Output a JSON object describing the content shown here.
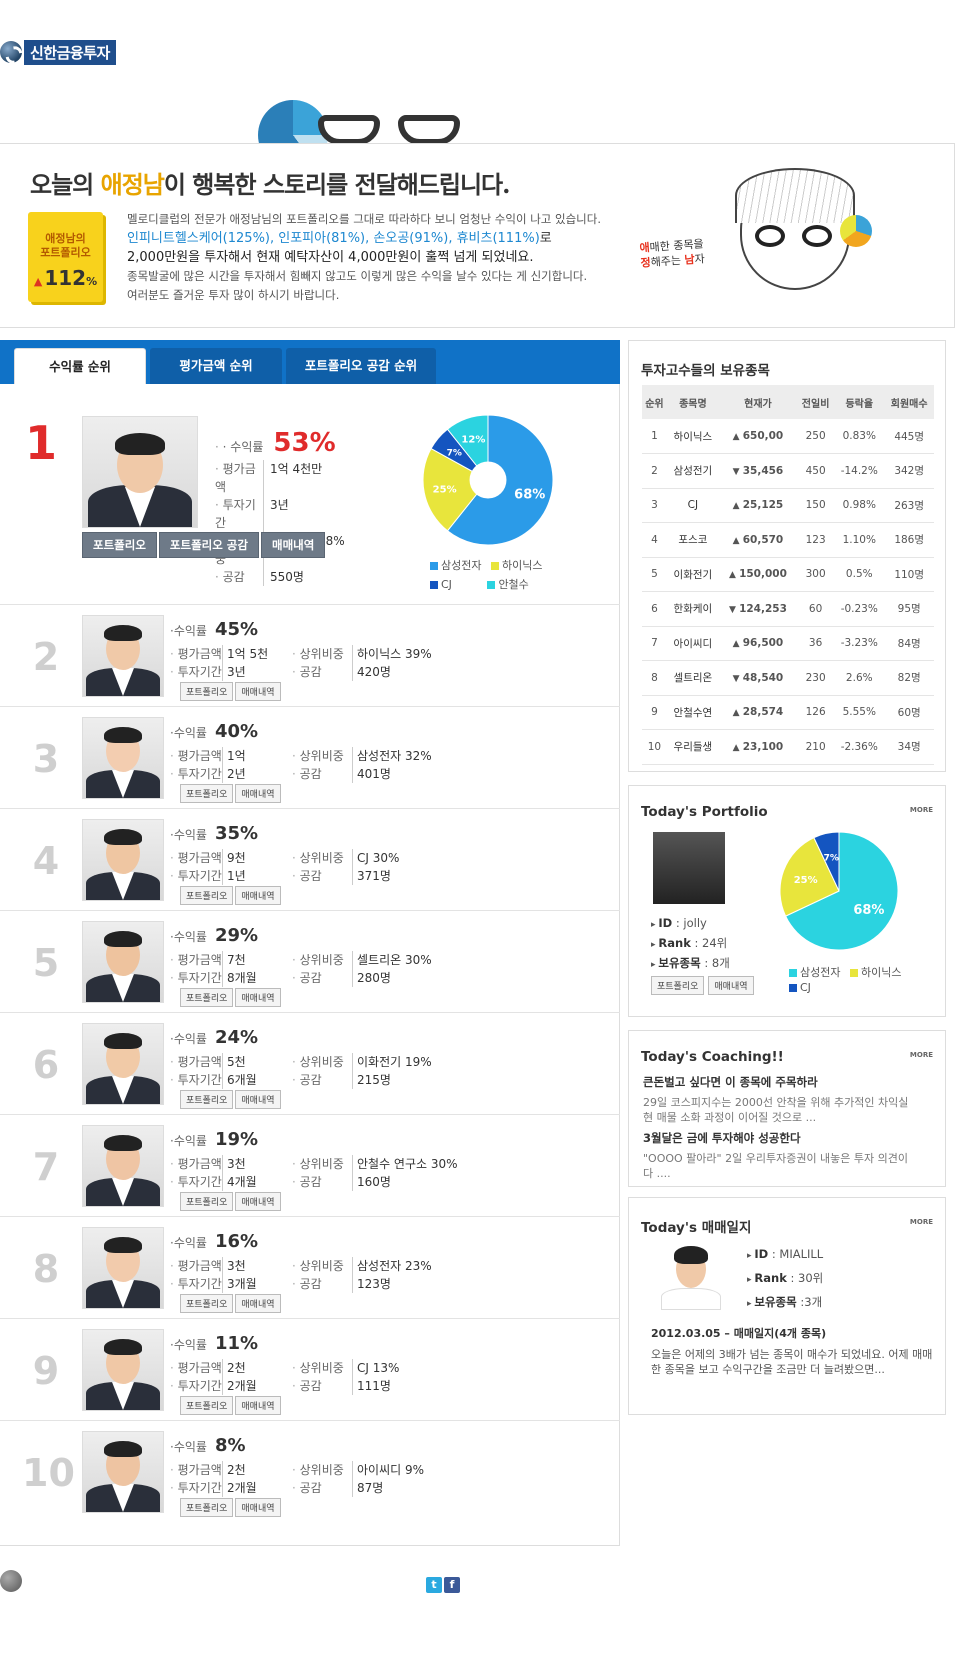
{
  "brand": {
    "logo_text": "신한금융투자"
  },
  "hero": {
    "title_pre": "오늘의 ",
    "title_highlight": "애정남",
    "title_post": "이 행복한 스토리를 전달해드립니다.",
    "badge_label1": "애정남의",
    "badge_label2": "포트폴리오",
    "badge_value": "112",
    "badge_unit": "%",
    "line1": "멜로디클럽의 전문가 애정남님의 포트폴리오를 그대로 따라하다 보니 엄청난 수익이 나고 있습니다.",
    "line2_blue": "인피니트헬스케어(125%), 인포피아(81%), 손오공(91%), 휴비츠(111%)",
    "line2_tail": "로",
    "line3": "2,000만원을 투자해서 현재 예탁자산이 4,000만원이 훌쩍 넘게 되었네요.",
    "line4": "종목발굴에 많은 시간을 투자해서 힘빼지 않고도 이렇게 많은 수익을 날수 있다는 게 신기합니다.",
    "line5": "여러분도 즐거운 투자 많이 하시기 바랍니다.",
    "tagline1_a": "애",
    "tagline1_b": "매한 종목을",
    "tagline2_a": "정",
    "tagline2_b": "해주는 ",
    "tagline2_c": "남",
    "tagline2_d": "자"
  },
  "tabs": [
    "수익률 순위",
    "평가금액 순위",
    "포트폴리오 공감 순위"
  ],
  "labels": {
    "yield": "수익률",
    "eval": "평가금액",
    "period": "투자기간",
    "top_ratio": "상위비중",
    "empathy": "공감",
    "btn_portfolio": "포트폴리오",
    "btn_portfolio_empathy": "포트폴리오 공감",
    "btn_trades": "매매내역"
  },
  "rank1": {
    "rank": "1",
    "yield": "53%",
    "eval": "1억 4천만",
    "period": "3년",
    "top": "삼성전자 68%",
    "empathy": "550명",
    "legend": [
      "삼성전자",
      "하이닉스",
      "CJ",
      "안철수"
    ]
  },
  "ranks": [
    {
      "rank": "2",
      "yield": "45%",
      "eval": "1억 5천",
      "period": "3년",
      "top": "하이닉스 39%",
      "empathy": "420명"
    },
    {
      "rank": "3",
      "yield": "40%",
      "eval": "1억",
      "period": "2년",
      "top": "삼성전자 32%",
      "empathy": "401명"
    },
    {
      "rank": "4",
      "yield": "35%",
      "eval": "9천",
      "period": "1년",
      "top": "CJ 30%",
      "empathy": "371명"
    },
    {
      "rank": "5",
      "yield": "29%",
      "eval": "7천",
      "period": "8개월",
      "top": "셀트리온 30%",
      "empathy": "280명"
    },
    {
      "rank": "6",
      "yield": "24%",
      "eval": "5천",
      "period": "6개월",
      "top": "이화전기 19%",
      "empathy": "215명"
    },
    {
      "rank": "7",
      "yield": "19%",
      "eval": "3천",
      "period": "4개월",
      "top": "안철수 연구소 30%",
      "empathy": "160명"
    },
    {
      "rank": "8",
      "yield": "16%",
      "eval": "3천",
      "period": "3개월",
      "top": "삼성전자 23%",
      "empathy": "123명"
    },
    {
      "rank": "9",
      "yield": "11%",
      "eval": "2천",
      "period": "2개월",
      "top": "CJ 13%",
      "empathy": "111명"
    },
    {
      "rank": "10",
      "yield": "8%",
      "eval": "2천",
      "period": "2개월",
      "top": "아이씨디 9%",
      "empathy": "87명"
    }
  ],
  "holdings": {
    "title": "투자고수들의 보유종목",
    "headers": [
      "순위",
      "종목명",
      "현재가",
      "전일비",
      "등락율",
      "회원매수"
    ],
    "rows": [
      [
        "1",
        "하이닉스",
        "650,00",
        "250",
        "0.83%",
        "445명",
        "up"
      ],
      [
        "2",
        "삼성전기",
        "35,456",
        "450",
        "-14.2%",
        "342명",
        "dn"
      ],
      [
        "3",
        "CJ",
        "25,125",
        "150",
        "0.98%",
        "263명",
        "up"
      ],
      [
        "4",
        "포스코",
        "60,570",
        "123",
        "1.10%",
        "186명",
        "up"
      ],
      [
        "5",
        "이화전기",
        "150,000",
        "300",
        "0.5%",
        "110명",
        "up"
      ],
      [
        "6",
        "한화케이",
        "124,253",
        "60",
        "-0.23%",
        "95명",
        "dn"
      ],
      [
        "7",
        "아이씨디",
        "96,500",
        "36",
        "-3.23%",
        "84명",
        "up"
      ],
      [
        "8",
        "셀트리온",
        "48,540",
        "230",
        "2.6%",
        "82명",
        "dn"
      ],
      [
        "9",
        "안철수연",
        "28,574",
        "126",
        "5.55%",
        "60명",
        "up"
      ],
      [
        "10",
        "우리들생",
        "23,100",
        "210",
        "-2.36%",
        "34명",
        "up"
      ]
    ]
  },
  "portfolio": {
    "title": "Today's Portfolio",
    "more": "MORE",
    "id_label": "ID",
    "id": ": jolly",
    "rank_label": "Rank",
    "rank": ": 24위",
    "count_label": "보유종목",
    "count": ": 8개",
    "legend": [
      "삼성전자",
      "하이닉스",
      "CJ"
    ]
  },
  "coaching": {
    "title": "Today's Coaching!!",
    "more": "MORE",
    "h1": "큰돈벌고 싶다면 이 종목에 주목하라",
    "p1": "29일 코스피지수는 2000선 안착을 위해 추가적인 차익실현 매물 소화 과정이 이어질 것으로 ...",
    "h2": "3월달은 금에 투자해야 성공한다",
    "p2": "\"OOOO 팔아라\" 2일 우리투자증권이 내놓은 투자 의견이다 ...."
  },
  "diary": {
    "title": "Today's 매매일지",
    "more": "MORE",
    "id_label": "ID",
    "id": ": MIALILL",
    "rank_label": "Rank",
    "rank": ": 30위",
    "count_label": "보유종목",
    "count": ":3개",
    "headline": "2012.03.05 – 매매일지(4개 종목)",
    "text": "오늘은 어제의 3배가 넘는 종목이 매수가 되었네요. 어제 매매한 종목을 보고 수익구간을 조금만 더 늘려봤으면..."
  },
  "colors": {
    "blue": "#1072c7",
    "red": "#e02b2b",
    "yellow": "#e8e53c",
    "cyan": "#2bd3e0",
    "pie_blue": "#2b9be8",
    "dark_blue": "#1455c0"
  },
  "chart_data": [
    {
      "type": "pie",
      "categories": [
        "삼성전자",
        "하이닉스",
        "CJ",
        "안철수"
      ],
      "values": [
        68,
        25,
        7,
        12
      ]
    },
    {
      "type": "pie",
      "categories": [
        "삼성전자",
        "하이닉스",
        "CJ"
      ],
      "values": [
        68,
        25,
        7
      ]
    }
  ],
  "social": [
    "t",
    "f"
  ]
}
